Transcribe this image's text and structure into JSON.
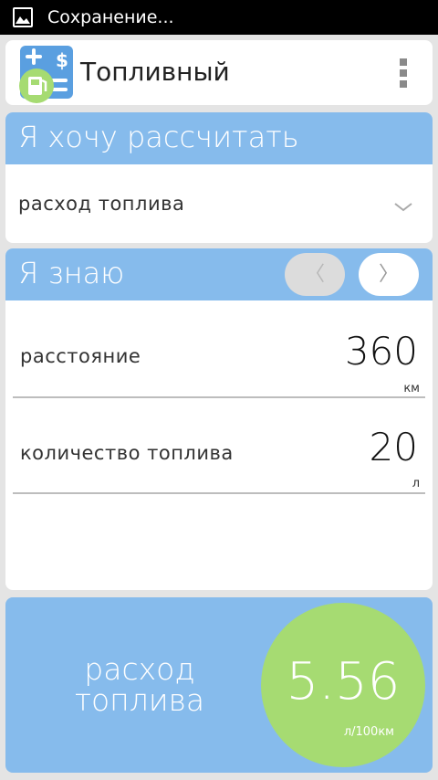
{
  "status_bar": {
    "text": "Сохранение..."
  },
  "app_bar": {
    "title": "Топливный"
  },
  "calculate_section": {
    "header": "Я хочу рассчитать",
    "selected": "расход топлива"
  },
  "know_section": {
    "header": "Я знаю",
    "prev_symbol": "〈",
    "next_symbol": "〉",
    "fields": [
      {
        "label": "расстояние",
        "value": "360",
        "unit": "км"
      },
      {
        "label": "количество топлива",
        "value": "20",
        "unit": "л"
      }
    ]
  },
  "result": {
    "label_line1": "расход",
    "label_line2": "топлива",
    "value": "5.56",
    "unit": "л/100км"
  },
  "colors": {
    "accent_blue": "#86bbec",
    "result_green": "#a6db72",
    "background": "#e4e4e4"
  }
}
